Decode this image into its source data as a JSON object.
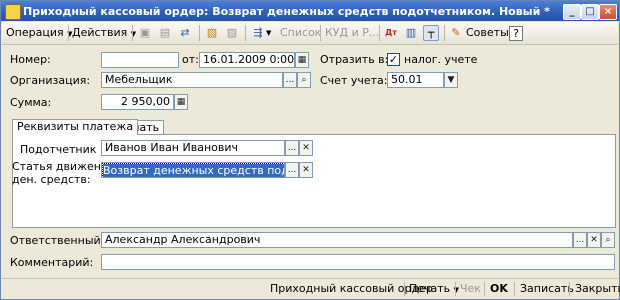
{
  "window": {
    "title": "Приходный кассовый ордер: Возврат денежных средств подотчетником. Новый *",
    "min": "_",
    "max": "□",
    "close": "×"
  },
  "toolbar": {
    "operation": "Операция",
    "actions": "Действия",
    "list": "Список",
    "kudir": "КУД и Р...",
    "advice": "Советы",
    "help": "?"
  },
  "form": {
    "number_label": "Номер:",
    "number_value": "",
    "date_label": "от:",
    "date_value": "16.01.2009  0:00:00",
    "reflect_label": "Отразить в:",
    "tax_accounting_label": "налог. учете",
    "tax_accounting_checked": "✓",
    "org_label": "Организация:",
    "org_value": "Мебельщик",
    "account_label": "Счет учета:",
    "account_value": "50.01",
    "sum_label": "Сумма:",
    "sum_value": "2 950,00"
  },
  "tabs": [
    {
      "label": "Реквизиты платежа"
    },
    {
      "label": "Печать"
    }
  ],
  "payment": {
    "accountable_label": "Подотчетник",
    "accountable_value": "Иванов Иван Иванович",
    "cashflow_label_line1": "Статья движения",
    "cashflow_label_line2": "ден. средств:",
    "cashflow_value": "Возврат денежных средств подотчетным"
  },
  "bottom": {
    "responsible_label": "Ответственный:",
    "responsible_value": "Александр Александрович",
    "comment_label": "Комментарий:",
    "comment_value": ""
  },
  "statusbar": {
    "order": "Приходный кассовый ордер",
    "print": "Печать",
    "check": "Чек",
    "ok": "OK",
    "save": "Записать",
    "close": "Закрыть"
  },
  "icons": {
    "ellipsis": "...",
    "clear": "✕",
    "search": "⌕",
    "dropdown": "▼",
    "calc": "▦"
  }
}
